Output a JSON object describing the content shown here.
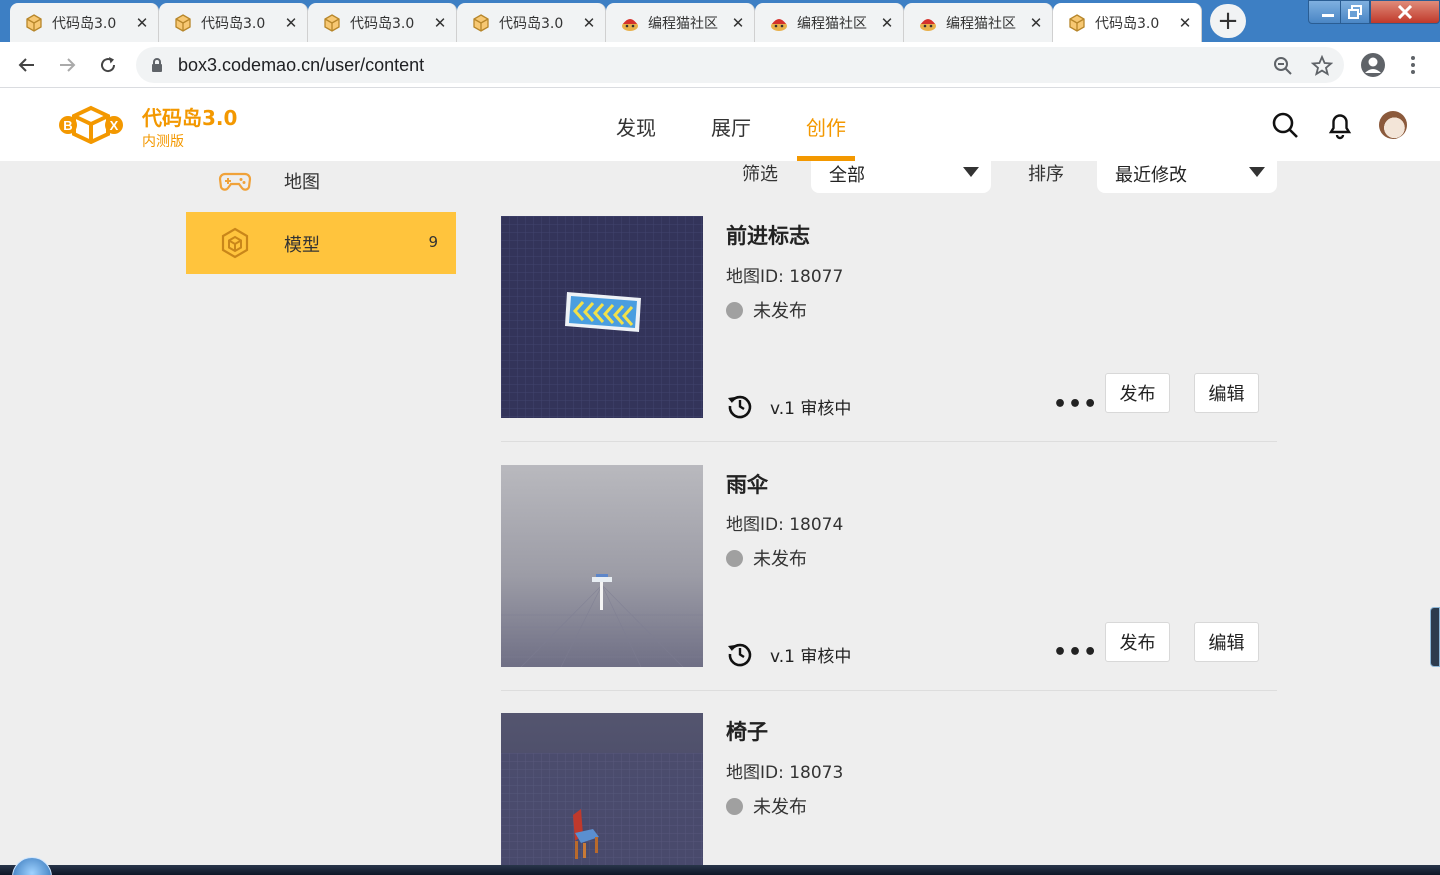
{
  "browser": {
    "tabs": [
      {
        "title": "代码岛3.0",
        "favicon": "box-icon",
        "active": false
      },
      {
        "title": "代码岛3.0",
        "favicon": "box-icon",
        "active": false
      },
      {
        "title": "代码岛3.0",
        "favicon": "box-icon",
        "active": false
      },
      {
        "title": "代码岛3.0",
        "favicon": "box-icon",
        "active": false
      },
      {
        "title": "编程猫社区",
        "favicon": "codemao-icon",
        "active": false
      },
      {
        "title": "编程猫社区",
        "favicon": "codemao-icon",
        "active": false
      },
      {
        "title": "编程猫社区",
        "favicon": "codemao-icon",
        "active": false
      },
      {
        "title": "代码岛3.0",
        "favicon": "box-icon",
        "active": true
      }
    ],
    "close_glyph": "✕",
    "new_tab_glyph": "+",
    "url": "box3.codemao.cn/user/content"
  },
  "header": {
    "brand": "代码岛3.0",
    "subtitle": "内测版",
    "logo_letters": [
      "B",
      "X"
    ],
    "nav": [
      {
        "label": "发现",
        "active": false
      },
      {
        "label": "展厅",
        "active": false
      },
      {
        "label": "创作",
        "active": true
      }
    ],
    "accent_color": "#f39800"
  },
  "sidebar": {
    "items": [
      {
        "label": "地图",
        "icon": "gamepad-icon",
        "active": false
      },
      {
        "label": "模型",
        "icon": "cube-icon",
        "active": true,
        "count": "9"
      }
    ],
    "active_color": "#ffc43d"
  },
  "filters": {
    "filter_label": "筛选",
    "filter_value": "全部",
    "sort_label": "排序",
    "sort_value": "最近修改"
  },
  "cards": [
    {
      "title": "前进标志",
      "map_id": "地图ID: 18077",
      "status": "未发布",
      "version": "v.1 审核中",
      "more": "•••",
      "publish": "发布",
      "edit": "编辑"
    },
    {
      "title": "雨伞",
      "map_id": "地图ID: 18074",
      "status": "未发布",
      "version": "v.1 审核中",
      "more": "•••",
      "publish": "发布",
      "edit": "编辑"
    },
    {
      "title": "椅子",
      "map_id": "地图ID: 18073",
      "status": "未发布"
    }
  ]
}
